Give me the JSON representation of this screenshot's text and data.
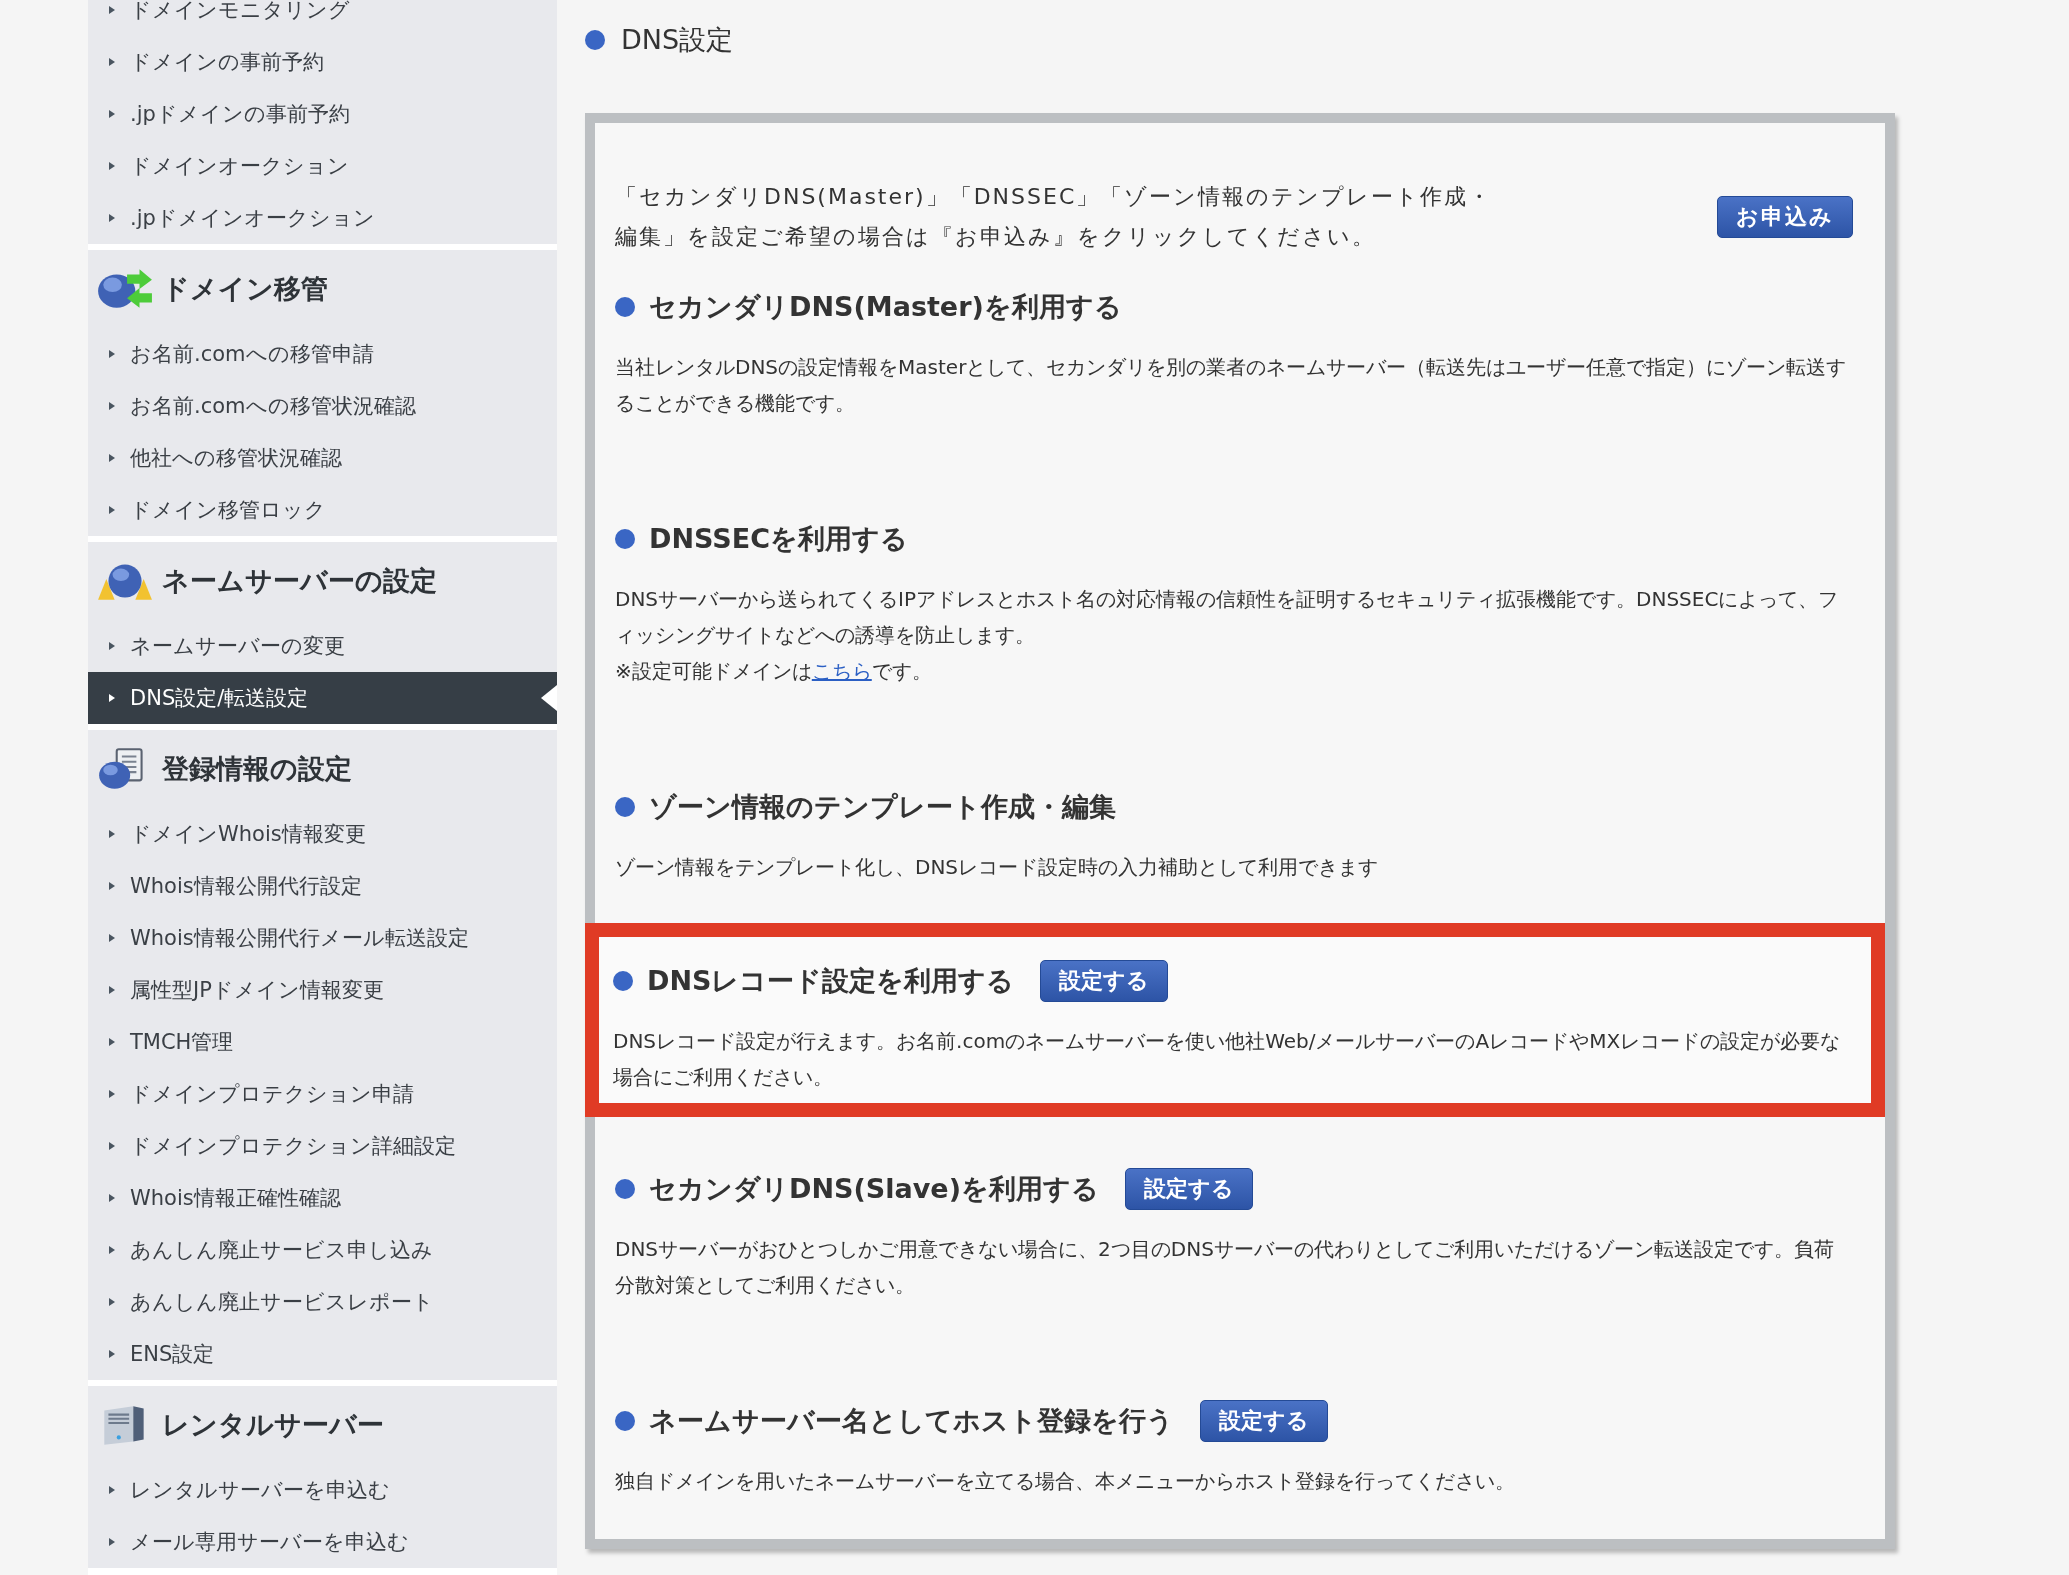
{
  "sidebar": {
    "groups": [
      {
        "items": [
          {
            "label": "ドメインモニタリング",
            "selected": false
          },
          {
            "label": "ドメインの事前予約",
            "selected": false
          },
          {
            "label": ".jpドメインの事前予約",
            "selected": false
          },
          {
            "label": "ドメインオークション",
            "selected": false
          },
          {
            "label": ".jpドメインオークション",
            "selected": false
          }
        ]
      },
      {
        "title": "ドメイン移管",
        "kind": "transfer",
        "items": [
          {
            "label": "お名前.comへの移管申請",
            "selected": false
          },
          {
            "label": "お名前.comへの移管状況確認",
            "selected": false
          },
          {
            "label": "他社への移管状況確認",
            "selected": false
          },
          {
            "label": "ドメイン移管ロック",
            "selected": false
          }
        ]
      },
      {
        "title": "ネームサーバーの設定",
        "kind": "nameserver",
        "items": [
          {
            "label": "ネームサーバーの変更",
            "selected": false
          },
          {
            "label": "DNS設定/転送設定",
            "selected": true
          }
        ]
      },
      {
        "title": "登録情報の設定",
        "kind": "registration",
        "items": [
          {
            "label": "ドメインWhois情報変更",
            "selected": false
          },
          {
            "label": "Whois情報公開代行設定",
            "selected": false
          },
          {
            "label": "Whois情報公開代行メール転送設定",
            "selected": false
          },
          {
            "label": "属性型JPドメイン情報変更",
            "selected": false
          },
          {
            "label": "TMCH管理",
            "selected": false
          },
          {
            "label": "ドメインプロテクション申請",
            "selected": false
          },
          {
            "label": "ドメインプロテクション詳細設定",
            "selected": false
          },
          {
            "label": "Whois情報正確性確認",
            "selected": false
          },
          {
            "label": "あんしん廃止サービス申し込み",
            "selected": false
          },
          {
            "label": "あんしん廃止サービスレポート",
            "selected": false
          },
          {
            "label": "ENS設定",
            "selected": false
          }
        ]
      },
      {
        "title": "レンタルサーバー",
        "kind": "server",
        "items": [
          {
            "label": "レンタルサーバーを申込む",
            "selected": false
          },
          {
            "label": "メール専用サーバーを申込む",
            "selected": false
          }
        ]
      }
    ]
  },
  "page_title": "DNS設定",
  "panel": {
    "intro_lines": [
      "「セカンダリDNS(Master)」「DNSSEC」「ゾーン情報のテンプレート作成・",
      "編集」を設定ご希望の場合は『お申込み』をクリックしてください。"
    ],
    "apply_button": "お申込み",
    "sections": [
      {
        "heading": "セカンダリDNS(Master)を利用する",
        "highlighted": false,
        "paragraphs": [
          {
            "text": "当社レンタルDNSの設定情報をMasterとして、セカンダリを別の業者のネームサーバー（転送先はユーザー任意で指定）にゾーン転送することができる機能です。"
          }
        ]
      },
      {
        "heading": "DNSSECを利用する",
        "highlighted": false,
        "paragraphs": [
          {
            "text": "DNSサーバーから送られてくるIPアドレスとホスト名の対応情報の信頼性を証明するセキュリティ拡張機能です。DNSSECによって、フィッシングサイトなどへの誘導を防止します。"
          },
          {
            "text": "※設定可能ドメインは",
            "link": "こちら",
            "after": "です。"
          }
        ]
      },
      {
        "heading": "ゾーン情報のテンプレート作成・編集",
        "highlighted": false,
        "paragraphs": [
          {
            "text": "ゾーン情報をテンプレート化し、DNSレコード設定時の入力補助として利用できます"
          }
        ]
      },
      {
        "heading": "DNSレコード設定を利用する",
        "button": "設定する",
        "highlighted": true,
        "paragraphs": [
          {
            "text": "DNSレコード設定が行えます。お名前.comのネームサーバーを使い他社Web/メールサーバーのAレコードやMXレコードの設定が必要な場合にご利用ください。"
          }
        ]
      },
      {
        "heading": "セカンダリDNS(Slave)を利用する",
        "button": "設定する",
        "highlighted": false,
        "paragraphs": [
          {
            "text": "DNSサーバーがおひとつしかご用意できない場合に、2つ目のDNSサーバーの代わりとしてご利用いただけるゾーン転送設定です。負荷分散対策としてご利用ください。"
          }
        ]
      },
      {
        "heading": "ネームサーバー名としてホスト登録を行う",
        "button": "設定する",
        "highlighted": false,
        "paragraphs": [
          {
            "text": "独自ドメインを用いたネームサーバーを立てる場合、本メニューからホスト登録を行ってください。"
          }
        ]
      }
    ]
  }
}
